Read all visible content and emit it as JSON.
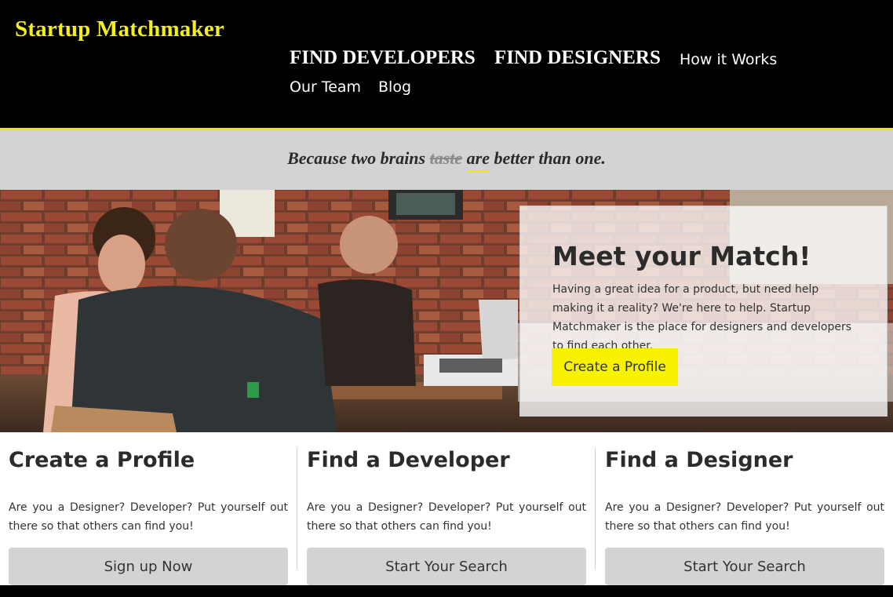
{
  "header": {
    "logo": "Startup Matchmaker",
    "nav": [
      {
        "label": "FIND DEVELOPERS"
      },
      {
        "label": "FIND DESIGNERS"
      },
      {
        "label": "How it Works"
      },
      {
        "label": "Our Team"
      },
      {
        "label": "Blog"
      }
    ]
  },
  "tagline": {
    "part1": "Because two brains ",
    "struck": "taste",
    "space": " ",
    "underlined": "are",
    "part2": " better than one."
  },
  "hero": {
    "title": "Meet your Match!",
    "text": "Having a great idea for a product, but need help making it a reality? We're here to help. Startup Matchmaker is the place for designers and developers to find each other.",
    "button": "Create a Profile"
  },
  "features": [
    {
      "title": "Create a Profile",
      "text": "Are you a Designer? Developer? Put yourself out there so that others can find you!",
      "button": "Sign up Now"
    },
    {
      "title": "Find a Developer",
      "text": "Are you a Designer? Developer? Put yourself out there so that others can find you!",
      "button": "Start Your Search"
    },
    {
      "title": "Find a Designer",
      "text": "Are you a Designer? Developer? Put yourself out there so that others can find you!",
      "button": "Start Your Search"
    }
  ],
  "colors": {
    "accent": "#f5ee1e",
    "header_bg": "#000000",
    "tagline_bg": "#d3d3d3",
    "button_bg": "#d3d3d3"
  }
}
